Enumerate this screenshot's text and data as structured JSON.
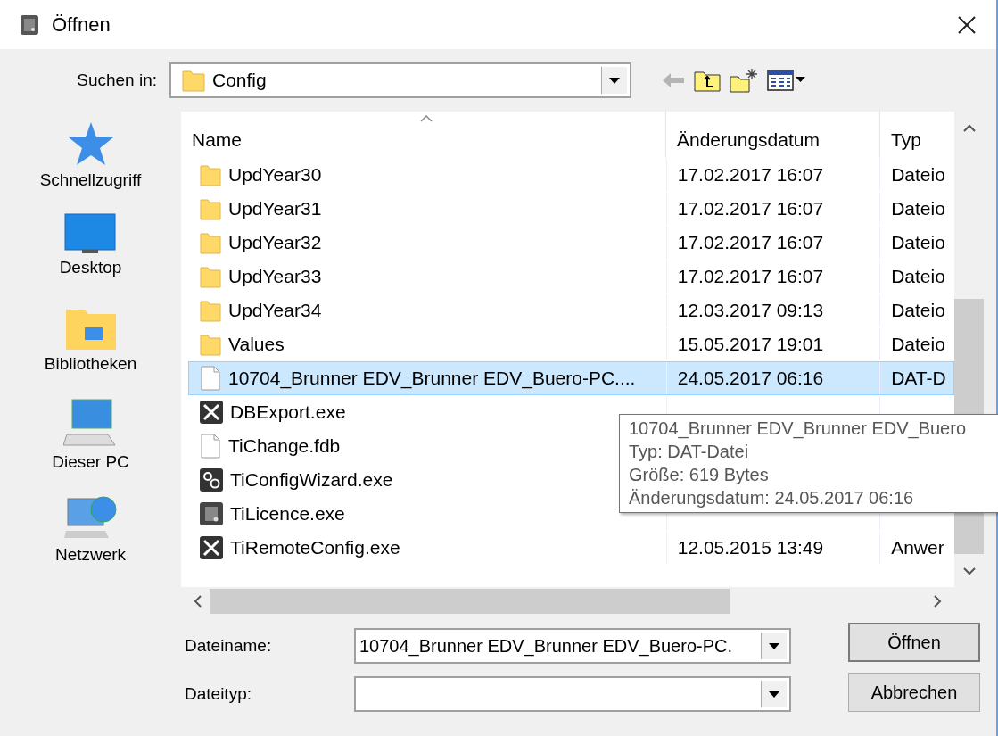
{
  "window": {
    "title": "Öffnen"
  },
  "look_in": {
    "label": "Suchen in:",
    "value": "Config"
  },
  "places": [
    {
      "label": "Schnellzugriff",
      "kind": "star"
    },
    {
      "label": "Desktop",
      "kind": "desktop"
    },
    {
      "label": "Bibliotheken",
      "kind": "library"
    },
    {
      "label": "Dieser PC",
      "kind": "pc"
    },
    {
      "label": "Netzwerk",
      "kind": "network"
    }
  ],
  "columns": [
    "Name",
    "Änderungsdatum",
    "Typ"
  ],
  "files": [
    {
      "name": "UpdYear30",
      "kind": "folder",
      "date": "17.02.2017 16:07",
      "type": "Dateio",
      "selected": false
    },
    {
      "name": "UpdYear31",
      "kind": "folder",
      "date": "17.02.2017 16:07",
      "type": "Dateio",
      "selected": false
    },
    {
      "name": "UpdYear32",
      "kind": "folder",
      "date": "17.02.2017 16:07",
      "type": "Dateio",
      "selected": false
    },
    {
      "name": "UpdYear33",
      "kind": "folder",
      "date": "17.02.2017 16:07",
      "type": "Dateio",
      "selected": false
    },
    {
      "name": "UpdYear34",
      "kind": "folder",
      "date": "12.03.2017 09:13",
      "type": "Dateio",
      "selected": false
    },
    {
      "name": "Values",
      "kind": "folder",
      "date": "15.05.2017 19:01",
      "type": "Dateio",
      "selected": false
    },
    {
      "name": "10704_Brunner EDV_Brunner EDV_Buero-PC....",
      "kind": "file",
      "date": "24.05.2017 06:16",
      "type": "DAT-D",
      "selected": true
    },
    {
      "name": "DBExport.exe",
      "kind": "tool",
      "selected": false
    },
    {
      "name": "TiChange.fdb",
      "kind": "file",
      "selected": false
    },
    {
      "name": "TiConfigWizard.exe",
      "kind": "gears",
      "selected": false
    },
    {
      "name": "TiLicence.exe",
      "kind": "app",
      "selected": false
    },
    {
      "name": "TiRemoteConfig.exe",
      "kind": "tool",
      "date": "12.05.2015 13:49",
      "type": "Anwer",
      "selected": false
    }
  ],
  "tooltip": {
    "lines": [
      "10704_Brunner EDV_Brunner EDV_Buero",
      "Typ: DAT-Datei",
      "Größe: 619 Bytes",
      "Änderungsdatum: 24.05.2017 06:16"
    ]
  },
  "file_name": {
    "label": "Dateiname:",
    "value": "10704_Brunner EDV_Brunner EDV_Buero-PC."
  },
  "file_type": {
    "label": "Dateityp:"
  },
  "buttons": [
    "Öffnen",
    "Abbrechen"
  ]
}
